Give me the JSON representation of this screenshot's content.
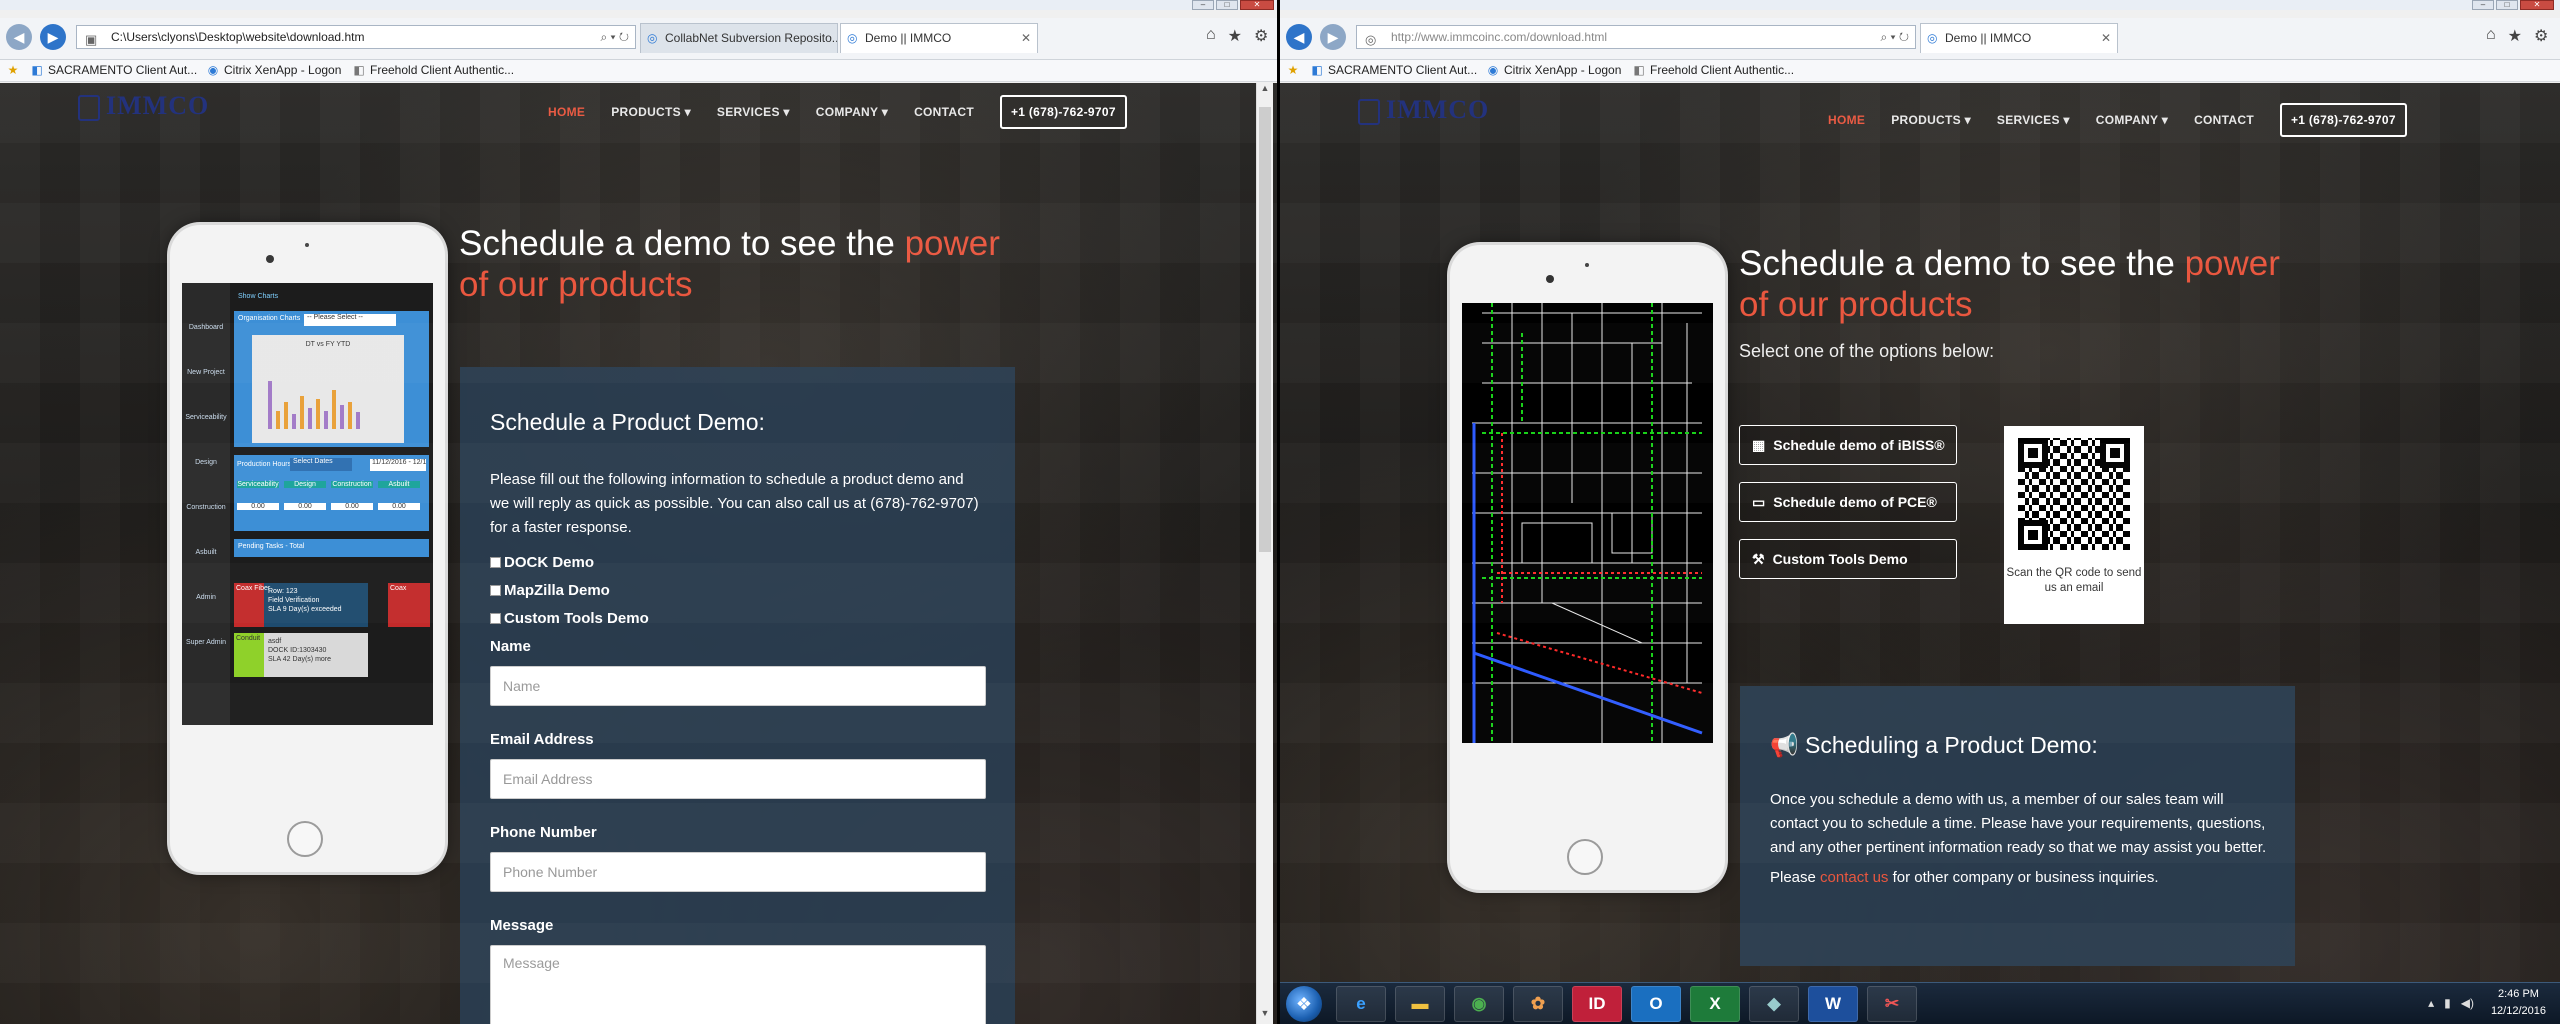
{
  "left": {
    "browser": {
      "url": "C:\\Users\\clyons\\Desktop\\website\\download.htm",
      "tabs": [
        {
          "label": "CollabNet Subversion Reposito..."
        },
        {
          "label": "Demo || IMMCO"
        }
      ],
      "favorites": [
        "SACRAMENTO Client Aut...",
        "Citrix XenApp - Logon",
        "Freehold Client Authentic..."
      ]
    },
    "site": {
      "logo": "IMMCO",
      "nav": [
        "HOME",
        "PRODUCTS",
        "SERVICES",
        "COMPANY",
        "CONTACT",
        "+1 (678)-762-9707"
      ],
      "headline_pre": "Schedule a demo to see the ",
      "headline_accent": "power of our products",
      "form": {
        "title": "Schedule a Product Demo:",
        "intro": "Please fill out the following information to schedule a product demo and we will reply as quick as possible. You can also call us at (678)-762-9707) for a faster response.",
        "checkboxes": [
          "DOCK Demo",
          "MapZilla Demo",
          "Custom Tools Demo"
        ],
        "fields": [
          {
            "label": "Name",
            "placeholder": "Name"
          },
          {
            "label": "Email Address",
            "placeholder": "Email Address"
          },
          {
            "label": "Phone Number",
            "placeholder": "Phone Number"
          },
          {
            "label": "Message",
            "placeholder": "Message"
          }
        ]
      },
      "phone_app": {
        "sidebar": [
          "Dashboard",
          "New Project",
          "Serviceability",
          "Design",
          "Construction",
          "Asbuilt",
          "Admin",
          "Super Admin"
        ],
        "header": "Show Charts",
        "org_label": "Organisation Charts",
        "org_select": "-- Please Select --",
        "chart_title": "DT vs FY YTD",
        "prod_label": "Production Hours",
        "prod_select": "Select Dates",
        "date": "11/12/2016 - 12/1",
        "cols": [
          "Serviceability",
          "Design",
          "Construction",
          "Asbuilt"
        ],
        "col_values": [
          "0.00",
          "0.00",
          "0.00",
          "0.00"
        ],
        "pending": "Pending Tasks - Total",
        "task1_head": "Coax Fiber",
        "task1_lines": [
          "Row: 123",
          "Field Verification",
          "SLA 9 Day(s) exceeded"
        ],
        "task2_head": "Conduit",
        "task2_lines": [
          "asdf",
          "DOCK ID:1303430",
          "SLA 42 Day(s) more"
        ],
        "coax": "Coax"
      }
    }
  },
  "right": {
    "browser": {
      "url": "http://www.immcoinc.com/download.html",
      "tabs": [
        {
          "label": "Demo || IMMCO"
        }
      ],
      "favorites": [
        "SACRAMENTO Client Aut...",
        "Citrix XenApp - Logon",
        "Freehold Client Authentic..."
      ]
    },
    "site": {
      "logo": "IMMCO",
      "nav": [
        "HOME",
        "PRODUCTS",
        "SERVICES",
        "COMPANY",
        "CONTACT",
        "+1 (678)-762-9707"
      ],
      "headline_pre": "Schedule a demo to see the ",
      "headline_accent": "power of our products",
      "subtitle": "Select one of the options below:",
      "options": [
        "Schedule demo of iBISS®",
        "Schedule demo of PCE®",
        "Custom Tools Demo"
      ],
      "qr_caption": "Scan the QR code to send us an email",
      "info": {
        "title": "Scheduling a Product Demo:",
        "body": "Once you schedule a demo with us, a member of our sales team will contact you to schedule a time. Please have your requirements, questions, and any other pertinent information ready so that we may assist you better.",
        "please": "Please ",
        "link": "contact us",
        "tail": " for other company or business inquiries."
      }
    },
    "taskbar": {
      "apps": [
        "IE",
        "Explorer",
        "Chrome",
        "Paint",
        "InDesign",
        "Outlook",
        "Excel",
        "Tool",
        "Word",
        "Snip"
      ],
      "time": "2:46 PM",
      "date": "12/12/2016"
    }
  },
  "colors": {
    "accent": "#e9573f",
    "panel": "#2a3e52",
    "logo": "#1e2d7a"
  }
}
